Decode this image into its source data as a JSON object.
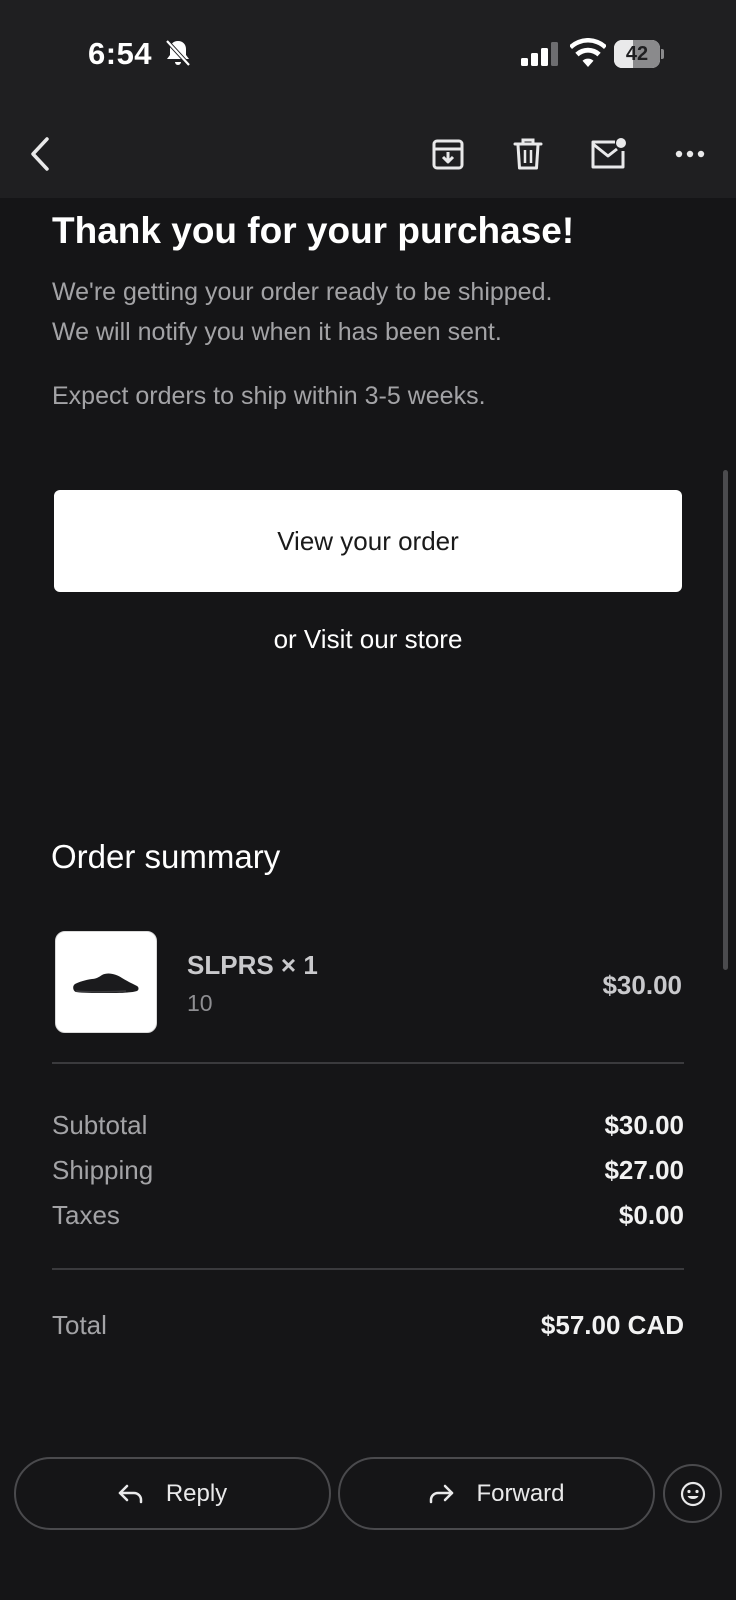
{
  "status_bar": {
    "time": "6:54",
    "battery_level": "42",
    "icons": [
      "bell-slash-icon",
      "cellular-signal-icon",
      "wifi-icon",
      "battery-icon"
    ]
  },
  "toolbar": {
    "icons": [
      "chevron-left-icon",
      "archive-icon",
      "trash-icon",
      "mail-unread-icon",
      "more-icon"
    ]
  },
  "email": {
    "heading": "Thank you for your purchase!",
    "line1": "We're getting your order ready to be shipped.",
    "line2": "We will notify you when it has been sent.",
    "line3": "Expect orders to ship within 3-5 weeks.",
    "view_order_label": "View your order",
    "visit_prefix": "or ",
    "visit_link": "Visit our store",
    "order_summary": {
      "title": "Order summary",
      "item": {
        "name": "SLPRS × 1",
        "variant": "10",
        "price": "$30.00",
        "image_icon": "shoe-icon"
      },
      "subtotal_label": "Subtotal",
      "subtotal_value": "$30.00",
      "shipping_label": "Shipping",
      "shipping_value": "$27.00",
      "taxes_label": "Taxes",
      "taxes_value": "$0.00",
      "total_label": "Total",
      "total_value": "$57.00 CAD"
    }
  },
  "actions": {
    "reply_label": "Reply",
    "forward_label": "Forward",
    "emoji_icon": "smiley-icon"
  },
  "colors": {
    "background": "#151517",
    "bar": "#1f1f21",
    "muted_text": "#a3a3a6",
    "button_bg": "#ffffff"
  }
}
